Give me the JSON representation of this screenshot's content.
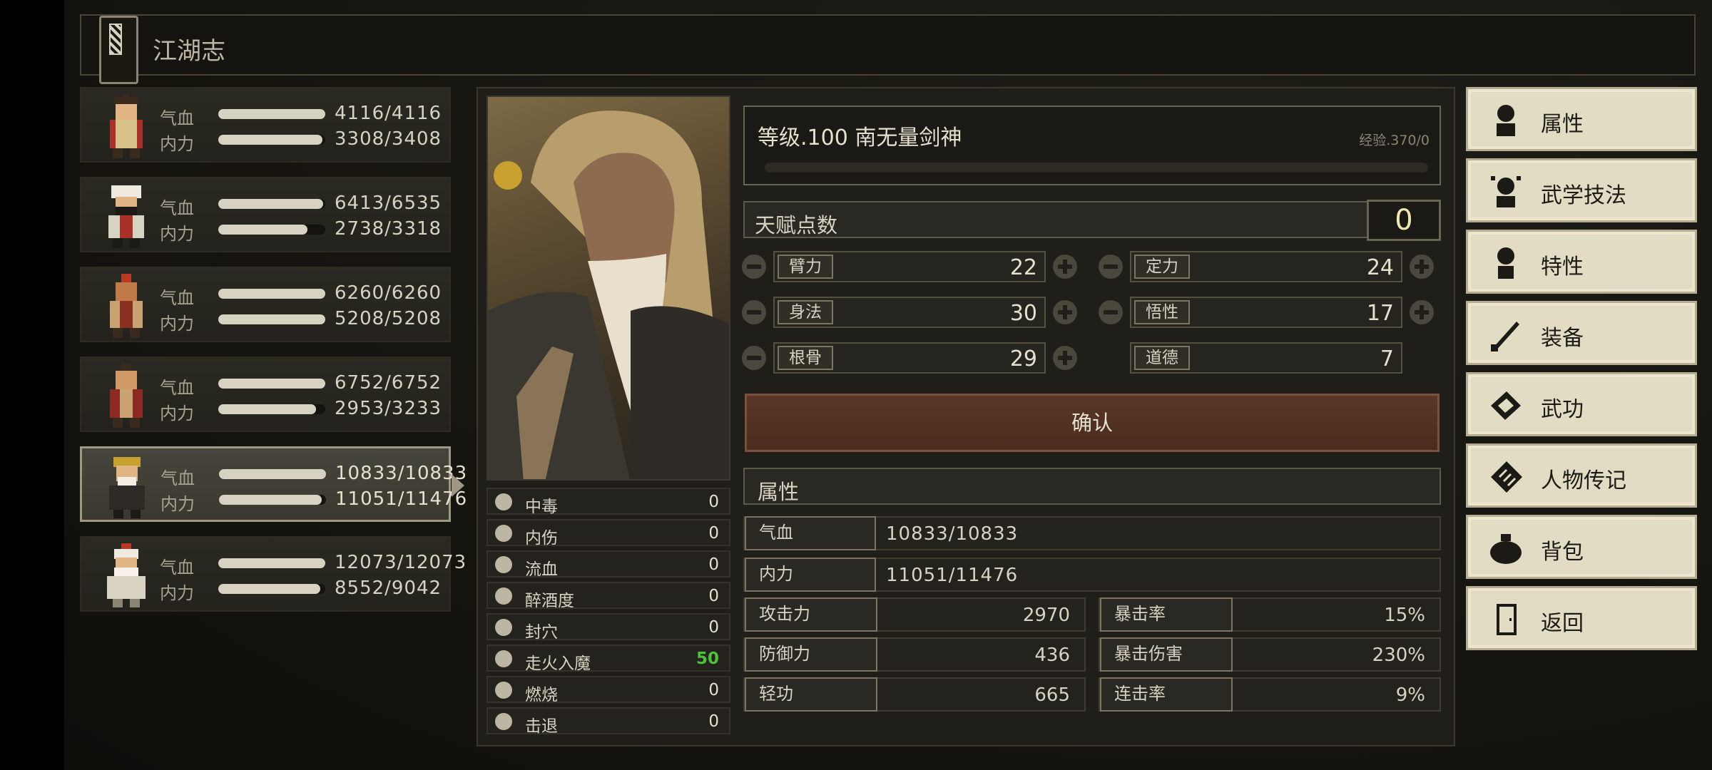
{
  "title": "江湖志",
  "party": [
    {
      "hp_label": "气血",
      "mp_label": "内力",
      "hp": "4116/4116",
      "mp": "3308/3408",
      "hp_pct": 1.0,
      "mp_pct": 0.97
    },
    {
      "hp_label": "气血",
      "mp_label": "内力",
      "hp": "6413/6535",
      "mp": "2738/3318",
      "hp_pct": 0.98,
      "mp_pct": 0.83
    },
    {
      "hp_label": "气血",
      "mp_label": "内力",
      "hp": "6260/6260",
      "mp": "5208/5208",
      "hp_pct": 1.0,
      "mp_pct": 1.0
    },
    {
      "hp_label": "气血",
      "mp_label": "内力",
      "hp": "6752/6752",
      "mp": "2953/3233",
      "hp_pct": 1.0,
      "mp_pct": 0.91
    },
    {
      "hp_label": "气血",
      "mp_label": "内力",
      "hp": "10833/10833",
      "mp": "11051/11476",
      "hp_pct": 1.0,
      "mp_pct": 0.96
    },
    {
      "hp_label": "气血",
      "mp_label": "内力",
      "hp": "12073/12073",
      "mp": "8552/9042",
      "hp_pct": 1.0,
      "mp_pct": 0.95
    }
  ],
  "selected_member": 4,
  "character": {
    "level_title": "等级.100 南无量剑神",
    "exp": "经验.370/0",
    "talent_label": "天赋点数",
    "talent_points": "0"
  },
  "stats": {
    "str_label": "臂力",
    "str": "22",
    "focus_label": "定力",
    "focus": "24",
    "agi_label": "身法",
    "agi": "30",
    "wis_label": "悟性",
    "wis": "17",
    "con_label": "根骨",
    "con": "29",
    "moral_label": "道德",
    "moral": "7"
  },
  "confirm_label": "确认",
  "attributes": {
    "header": "属性",
    "hp_label": "气血",
    "hp": "10833/10833",
    "mp_label": "内力",
    "mp": "11051/11476",
    "atk_label": "攻击力",
    "atk": "2970",
    "crit_label": "暴击率",
    "crit": "15%",
    "def_label": "防御力",
    "def": "436",
    "critdmg_label": "暴击伤害",
    "critdmg": "230%",
    "qinggong_label": "轻功",
    "qinggong": "665",
    "combo_label": "连击率",
    "combo": "9%"
  },
  "status_effects": [
    {
      "name": "中毒",
      "value": "0",
      "icon": "skull-icon"
    },
    {
      "name": "内伤",
      "value": "0",
      "icon": "broken-heart-icon"
    },
    {
      "name": "流血",
      "value": "0",
      "icon": "blood-icon"
    },
    {
      "name": "醉酒度",
      "value": "0",
      "icon": "drunk-icon"
    },
    {
      "name": "封穴",
      "value": "0",
      "icon": "acupoint-icon"
    },
    {
      "name": "走火入魔",
      "value": "50",
      "icon": "possessed-icon",
      "highlight": "#4cc23a"
    },
    {
      "name": "燃烧",
      "value": "0",
      "icon": "fire-icon"
    },
    {
      "name": "击退",
      "value": "0",
      "icon": "boot-icon"
    }
  ],
  "menu": [
    {
      "label": "属性",
      "icon": "attribute-icon"
    },
    {
      "label": "武学技法",
      "icon": "martial-skill-icon"
    },
    {
      "label": "特性",
      "icon": "trait-icon"
    },
    {
      "label": "装备",
      "icon": "sword-icon"
    },
    {
      "label": "武功",
      "icon": "manual-icon"
    },
    {
      "label": "人物传记",
      "icon": "biography-icon"
    },
    {
      "label": "背包",
      "icon": "bag-icon"
    },
    {
      "label": "返回",
      "icon": "door-icon"
    }
  ],
  "colors": {
    "accent": "#e3dcc4",
    "confirm": "#5a3726",
    "highlight_green": "#4cc23a"
  }
}
